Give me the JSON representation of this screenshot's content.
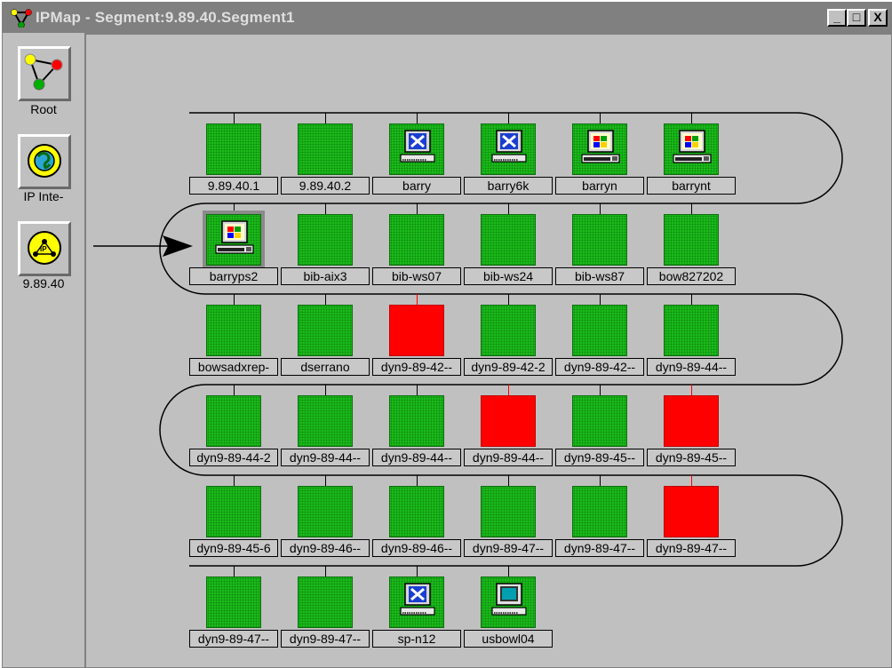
{
  "window": {
    "title": "IPMap - Segment:9.89.40.Segment1",
    "controls": {
      "minimize": "_",
      "maximize": "□",
      "close": "X"
    }
  },
  "left_panel": {
    "items": [
      {
        "label": "Root",
        "icon": "triangle-network-icon"
      },
      {
        "label": "IP Inte-",
        "icon": "globe-icon"
      },
      {
        "label": "9.89.40",
        "icon": "ip-network-icon"
      }
    ]
  },
  "colors": {
    "up": "#1bbf1b",
    "down": "#ff0000",
    "background": "#c0c0c0",
    "title_bar": "#808080"
  },
  "nodes": [
    {
      "label": "9.89.40.1",
      "status": "up",
      "icon": "none"
    },
    {
      "label": "9.89.40.2",
      "status": "up",
      "icon": "none"
    },
    {
      "label": "barry",
      "status": "up",
      "icon": "x-terminal-icon"
    },
    {
      "label": "barry6k",
      "status": "up",
      "icon": "x-terminal-icon"
    },
    {
      "label": "barryn",
      "status": "up",
      "icon": "windows-workstation-icon"
    },
    {
      "label": "barrynt",
      "status": "up",
      "icon": "windows-workstation-icon"
    },
    {
      "label": "barryps2",
      "status": "up",
      "icon": "windows-workstation-icon",
      "selected": true
    },
    {
      "label": "bib-aix3",
      "status": "up",
      "icon": "none"
    },
    {
      "label": "bib-ws07",
      "status": "up",
      "icon": "none"
    },
    {
      "label": "bib-ws24",
      "status": "up",
      "icon": "none"
    },
    {
      "label": "bib-ws87",
      "status": "up",
      "icon": "none"
    },
    {
      "label": "bow827202",
      "status": "up",
      "icon": "none"
    },
    {
      "label": "bowsadxrep-",
      "status": "up",
      "icon": "none"
    },
    {
      "label": "dserrano",
      "status": "up",
      "icon": "none"
    },
    {
      "label": "dyn9-89-42--",
      "status": "down",
      "icon": "none"
    },
    {
      "label": "dyn9-89-42-2",
      "status": "up",
      "icon": "none"
    },
    {
      "label": "dyn9-89-42--",
      "status": "up",
      "icon": "none"
    },
    {
      "label": "dyn9-89-44--",
      "status": "up",
      "icon": "none"
    },
    {
      "label": "dyn9-89-44-2",
      "status": "up",
      "icon": "none"
    },
    {
      "label": "dyn9-89-44--",
      "status": "up",
      "icon": "none"
    },
    {
      "label": "dyn9-89-44--",
      "status": "up",
      "icon": "none"
    },
    {
      "label": "dyn9-89-44--",
      "status": "down",
      "icon": "none"
    },
    {
      "label": "dyn9-89-45--",
      "status": "up",
      "icon": "none"
    },
    {
      "label": "dyn9-89-45--",
      "status": "down",
      "icon": "none"
    },
    {
      "label": "dyn9-89-45-6",
      "status": "up",
      "icon": "none"
    },
    {
      "label": "dyn9-89-46--",
      "status": "up",
      "icon": "none"
    },
    {
      "label": "dyn9-89-46--",
      "status": "up",
      "icon": "none"
    },
    {
      "label": "dyn9-89-47--",
      "status": "up",
      "icon": "none"
    },
    {
      "label": "dyn9-89-47--",
      "status": "up",
      "icon": "none"
    },
    {
      "label": "dyn9-89-47--",
      "status": "down",
      "icon": "none"
    },
    {
      "label": "dyn9-89-47--",
      "status": "up",
      "icon": "none"
    },
    {
      "label": "dyn9-89-47--",
      "status": "up",
      "icon": "none"
    },
    {
      "label": "sp-n12",
      "status": "up",
      "icon": "x-terminal-icon"
    },
    {
      "label": "usbowl04",
      "status": "up",
      "icon": "pc-workstation-icon"
    }
  ]
}
